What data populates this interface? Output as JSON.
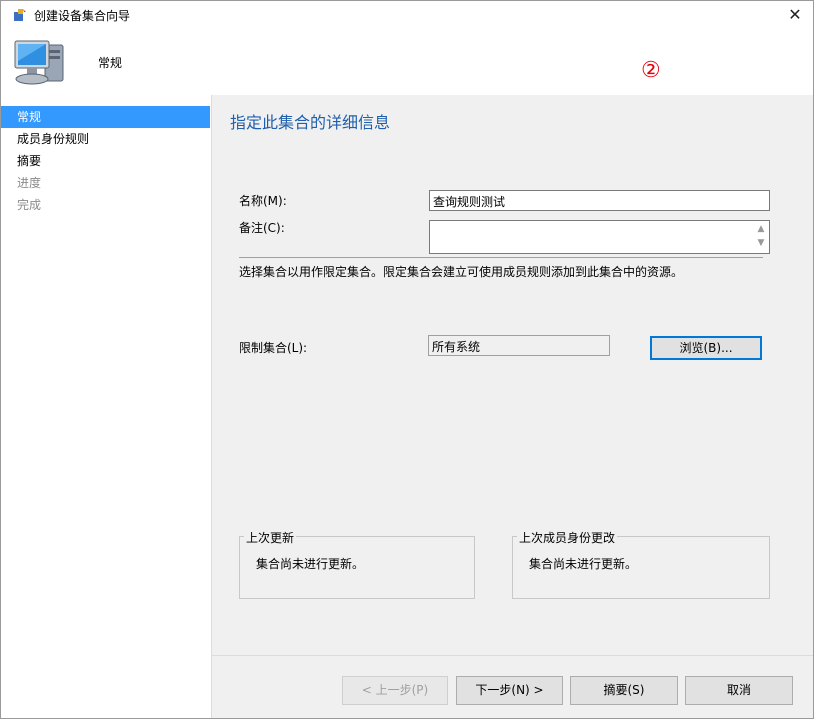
{
  "window": {
    "title": "创建设备集合向导",
    "close_glyph": "✕",
    "banner_title": "常规",
    "annotation": "②"
  },
  "icons": {
    "title": "wizard-icon",
    "banner": "computer-icon"
  },
  "sidebar": {
    "items": [
      {
        "label": "常规",
        "state": "active"
      },
      {
        "label": "成员身份规则",
        "state": "normal"
      },
      {
        "label": "摘要",
        "state": "normal"
      },
      {
        "label": "进度",
        "state": "disabled"
      },
      {
        "label": "完成",
        "state": "disabled"
      }
    ]
  },
  "main": {
    "heading": "指定此集合的详细信息",
    "name_label": "名称(M):",
    "name_value": "查询规则测试",
    "comment_label": "备注(C):",
    "comment_value": "",
    "description": "选择集合以用作限定集合。限定集合会建立可使用成员规则添加到此集合中的资源。",
    "limit_label": "限制集合(L):",
    "limit_value": "所有系统",
    "browse_label": "浏览(B)...",
    "last_update_title": "上次更新",
    "last_update_text": "集合尚未进行更新。",
    "last_membership_title": "上次成员身份更改",
    "last_membership_text": "集合尚未进行更新。"
  },
  "footer": {
    "prev_label": "< 上一步(P)",
    "next_label": "下一步(N) >",
    "summary_label": "摘要(S)",
    "cancel_label": "取消"
  },
  "colors": {
    "accent": "#3399ff",
    "heading": "#1f5fad",
    "annotation": "#e8000f",
    "focus_border": "#0078d7"
  }
}
